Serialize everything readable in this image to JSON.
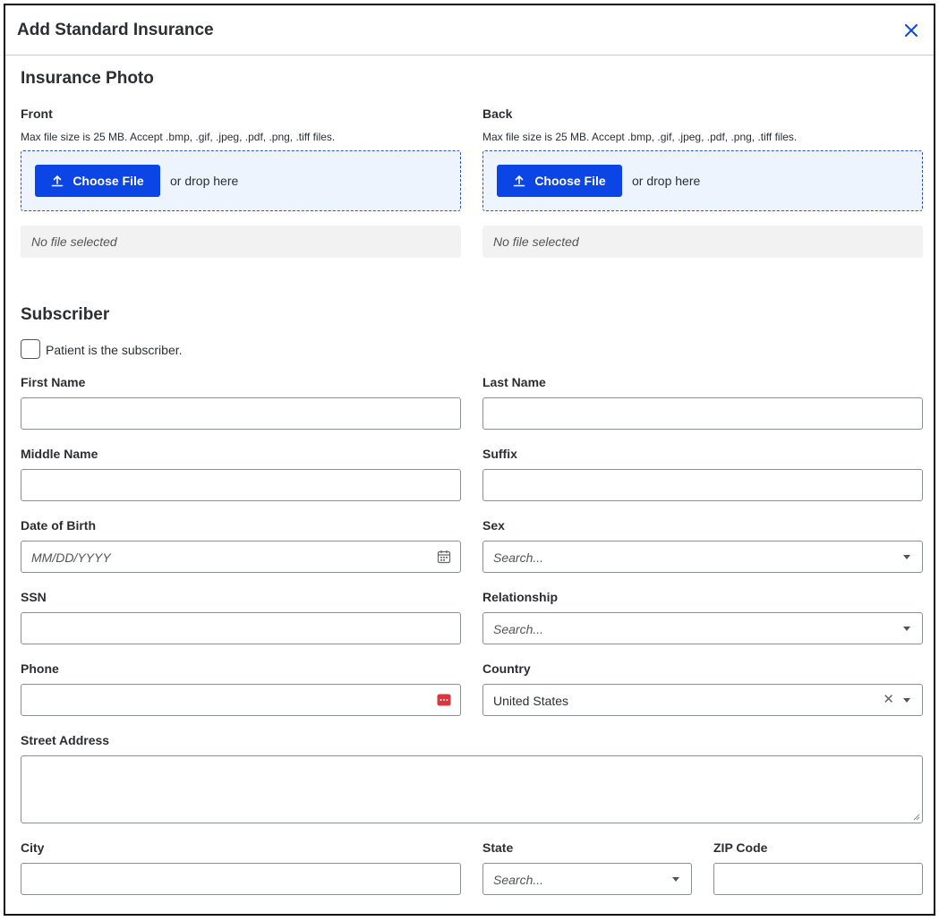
{
  "modal": {
    "title": "Add Standard Insurance",
    "close_icon": "close-icon",
    "accent_color": "#0b45e6"
  },
  "insurance_photo": {
    "title": "Insurance Photo",
    "front": {
      "label": "Front",
      "hint": "Max file size is 25 MB. Accept .bmp, .gif, .jpeg, .pdf, .png, .tiff files.",
      "button": "Choose File",
      "drop_text": "or drop here",
      "status": "No file selected"
    },
    "back": {
      "label": "Back",
      "hint": "Max file size is 25 MB. Accept .bmp, .gif, .jpeg, .pdf, .png, .tiff files.",
      "button": "Choose File",
      "drop_text": "or drop here",
      "status": "No file selected"
    }
  },
  "subscriber": {
    "title": "Subscriber",
    "patient_is_subscriber": {
      "label": "Patient is the subscriber.",
      "checked": false
    },
    "fields": {
      "first_name": {
        "label": "First Name",
        "value": ""
      },
      "last_name": {
        "label": "Last Name",
        "value": ""
      },
      "middle_name": {
        "label": "Middle Name",
        "value": ""
      },
      "suffix": {
        "label": "Suffix",
        "value": ""
      },
      "dob": {
        "label": "Date of Birth",
        "placeholder": "MM/DD/YYYY"
      },
      "sex": {
        "label": "Sex",
        "placeholder": "Search..."
      },
      "ssn": {
        "label": "SSN",
        "value": ""
      },
      "relationship": {
        "label": "Relationship",
        "placeholder": "Search..."
      },
      "phone": {
        "label": "Phone",
        "value": ""
      },
      "country": {
        "label": "Country",
        "value": "United States"
      },
      "street": {
        "label": "Street Address",
        "value": ""
      },
      "city": {
        "label": "City",
        "value": ""
      },
      "state": {
        "label": "State",
        "placeholder": "Search..."
      },
      "zip": {
        "label": "ZIP Code",
        "value": ""
      }
    }
  }
}
